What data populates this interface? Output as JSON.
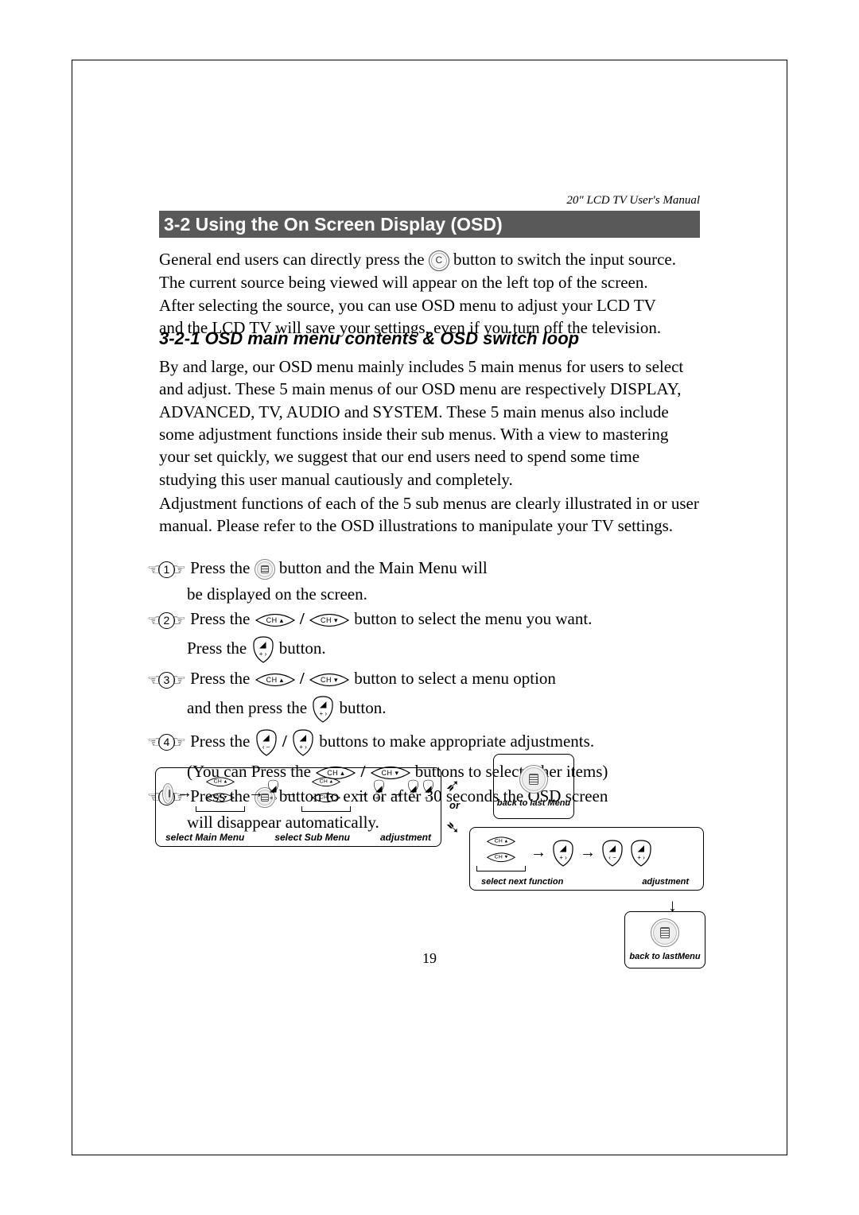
{
  "header_right": "20\" LCD TV User's Manual",
  "section_title": "3-2  Using the On Screen Display (OSD)",
  "intro_lines": [
    "General end users can directly press the",
    "button to switch the input source.",
    "The current source being viewed will appear on the left top of the screen.",
    "After selecting the source, you can use OSD menu to adjust your LCD TV",
    "and the LCD TV will save your settings, even if you turn off the television."
  ],
  "subheading": "3-2-1  OSD main menu contents & OSD switch loop",
  "body1": "By and large, our OSD menu mainly includes 5 main menus for users to select and adjust. These 5 main menus of our OSD menu are respectively DISPLAY, ADVANCED, TV, AUDIO and SYSTEM. These 5 main menus also include some adjustment functions inside their sub menus. With a view to mastering your set quickly, we suggest that our end users need to spend some time studying this user manual cautiously and completely.",
  "body2": "Adjustment functions of each of the 5 sub menus are clearly illustrated in or user manual. Please refer to the OSD illustrations to manipulate your TV settings.",
  "steps": {
    "s1a": "Press the",
    "s1b": "button and the Main Menu will",
    "s1c": "be displayed on the screen.",
    "s2a": "Press the",
    "s2b": "button to select the menu you want.",
    "s2c": "Press the",
    "s2d": "button.",
    "s3a": "Press the",
    "s3b": "button to select a menu option",
    "s3c": "and then press the",
    "s3d": "button.",
    "s4a": "Press the",
    "s4b": "buttons to make appropriate adjustments.",
    "s4c": "(You can Press the",
    "s4d": "buttons to select other items)",
    "s5a": "Press the",
    "s5b": "button to exit or after 30 seconds the OSD screen",
    "s5c": "will disappear automatically."
  },
  "labels": {
    "ch_up": "CH",
    "ch_dn": "CH",
    "slash": "/",
    "or": "or",
    "select_main": "select Main Menu",
    "select_sub": "select Sub Menu",
    "adjustment": "adjustment",
    "back_last": "back to last Menu",
    "select_next": "select next function",
    "back_last2": "back to lastMenu"
  },
  "page_number": "19"
}
